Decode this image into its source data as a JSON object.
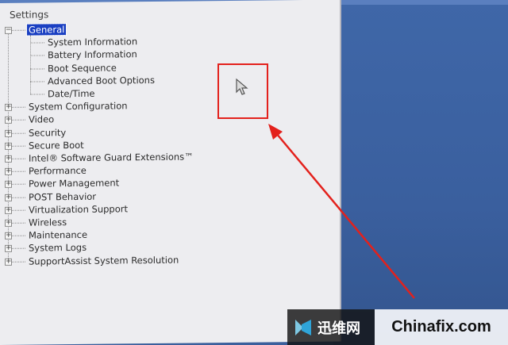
{
  "panel": {
    "title": "Settings"
  },
  "tree": [
    {
      "label": "General",
      "expanded": true,
      "selected": true,
      "level": 0,
      "children": [
        {
          "label": "System Information"
        },
        {
          "label": "Battery Information"
        },
        {
          "label": "Boot Sequence"
        },
        {
          "label": "Advanced Boot Options"
        },
        {
          "label": "Date/Time"
        }
      ]
    },
    {
      "label": "System Configuration",
      "level": 0
    },
    {
      "label": "Video",
      "level": 0
    },
    {
      "label": "Security",
      "level": 0
    },
    {
      "label": "Secure Boot",
      "level": 0
    },
    {
      "label": "Intel® Software Guard Extensions™",
      "level": 0
    },
    {
      "label": "Performance",
      "level": 0
    },
    {
      "label": "Power Management",
      "level": 0
    },
    {
      "label": "POST Behavior",
      "level": 0
    },
    {
      "label": "Virtualization Support",
      "level": 0
    },
    {
      "label": "Wireless",
      "level": 0
    },
    {
      "label": "Maintenance",
      "level": 0
    },
    {
      "label": "System Logs",
      "level": 0
    },
    {
      "label": "SupportAssist System Resolution",
      "level": 0
    }
  ],
  "expander": {
    "collapsed": "+",
    "expanded": "−"
  },
  "watermark": {
    "cn_text": "迅维网",
    "en_text": "Chinafix.com",
    "logo_icon": "chinafix-logo-icon"
  },
  "colors": {
    "selection": "#1a3fc2",
    "highlight": "#e3211c",
    "background": "#3b5f9c",
    "panel": "#ededf0"
  }
}
